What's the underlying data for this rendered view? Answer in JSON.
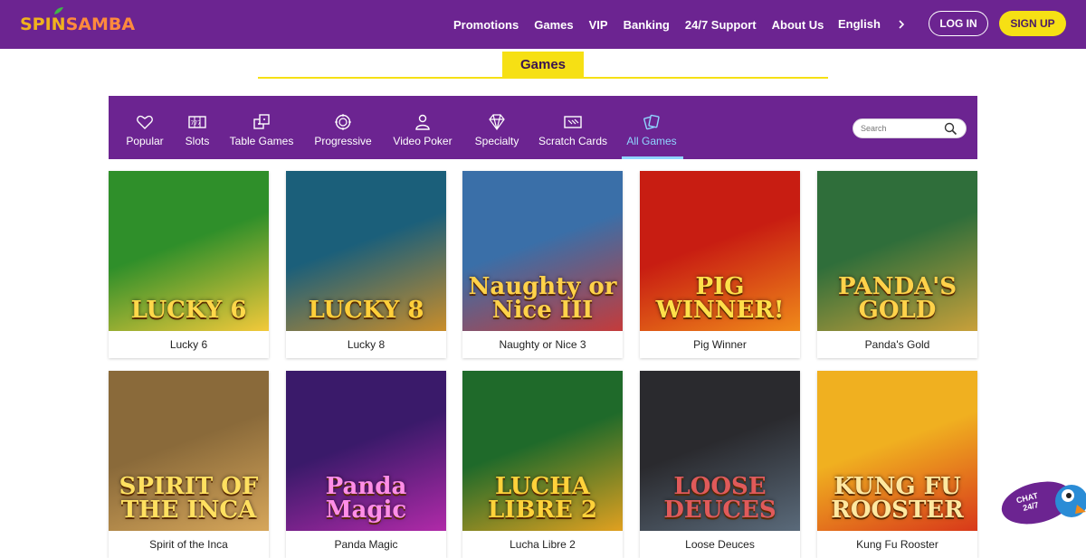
{
  "brand": {
    "logo_part1": "SPIN",
    "logo_part2": "SAMBA"
  },
  "nav": {
    "items": [
      "Promotions",
      "Games",
      "VIP",
      "Banking",
      "24/7 Support",
      "About Us"
    ]
  },
  "language": "English",
  "auth": {
    "login": "LOG IN",
    "signup": "SIGN UP"
  },
  "section_title": "Games",
  "categories": [
    {
      "label": "Popular",
      "icon": "heart-icon"
    },
    {
      "label": "Slots",
      "icon": "slots-icon"
    },
    {
      "label": "Table Games",
      "icon": "dice-icon"
    },
    {
      "label": "Progressive",
      "icon": "progressive-icon"
    },
    {
      "label": "Video Poker",
      "icon": "player-icon"
    },
    {
      "label": "Specialty",
      "icon": "diamond-icon"
    },
    {
      "label": "Scratch Cards",
      "icon": "scratch-card-icon"
    },
    {
      "label": "All Games",
      "icon": "cards-icon",
      "active": true
    }
  ],
  "search": {
    "placeholder": "Search"
  },
  "games": [
    {
      "title": "Lucky 6",
      "art": "LUCKY 6",
      "bg": "#2f8f2a",
      "bg2": "#f3c93a",
      "fg": "#ffd84a"
    },
    {
      "title": "Lucky 8",
      "art": "LUCKY 8",
      "bg": "#1b5f7a",
      "bg2": "#c98d2a",
      "fg": "#ffcf3a"
    },
    {
      "title": "Naughty or Nice 3",
      "art": "Naughty or Nice III",
      "bg": "#3a6fa8",
      "bg2": "#c43b3b",
      "fg": "#ffd24a"
    },
    {
      "title": "Pig Winner",
      "art": "PIG WINNER!",
      "bg": "#c81d12",
      "bg2": "#f08a1a",
      "fg": "#ffe04a"
    },
    {
      "title": "Panda's Gold",
      "art": "PANDA'S GOLD",
      "bg": "#2f6e3a",
      "bg2": "#c8a03a",
      "fg": "#ffd24a"
    },
    {
      "title": "Spirit of the Inca",
      "art": "SPIRIT OF THE INCA",
      "bg": "#8a6a3a",
      "bg2": "#d6a65a",
      "fg": "#ffe060"
    },
    {
      "title": "Panda Magic",
      "art": "Panda Magic",
      "bg": "#3a1a6a",
      "bg2": "#b02aa8",
      "fg": "#ff8ee8"
    },
    {
      "title": "Lucha Libre 2",
      "art": "LUCHA LIBRE 2",
      "bg": "#1f6a2a",
      "bg2": "#e0a020",
      "fg": "#ffd23a"
    },
    {
      "title": "Loose Deuces",
      "art": "LOOSE DEUCES",
      "bg": "#2a2a2e",
      "bg2": "#5a6a7a",
      "fg": "#e05a5a"
    },
    {
      "title": "Kung Fu Rooster",
      "art": "KUNG FU ROOSTER",
      "bg": "#f0b020",
      "bg2": "#d8381a",
      "fg": "#ffe8a0"
    }
  ],
  "chat": {
    "label": "CHAT 24/7"
  }
}
